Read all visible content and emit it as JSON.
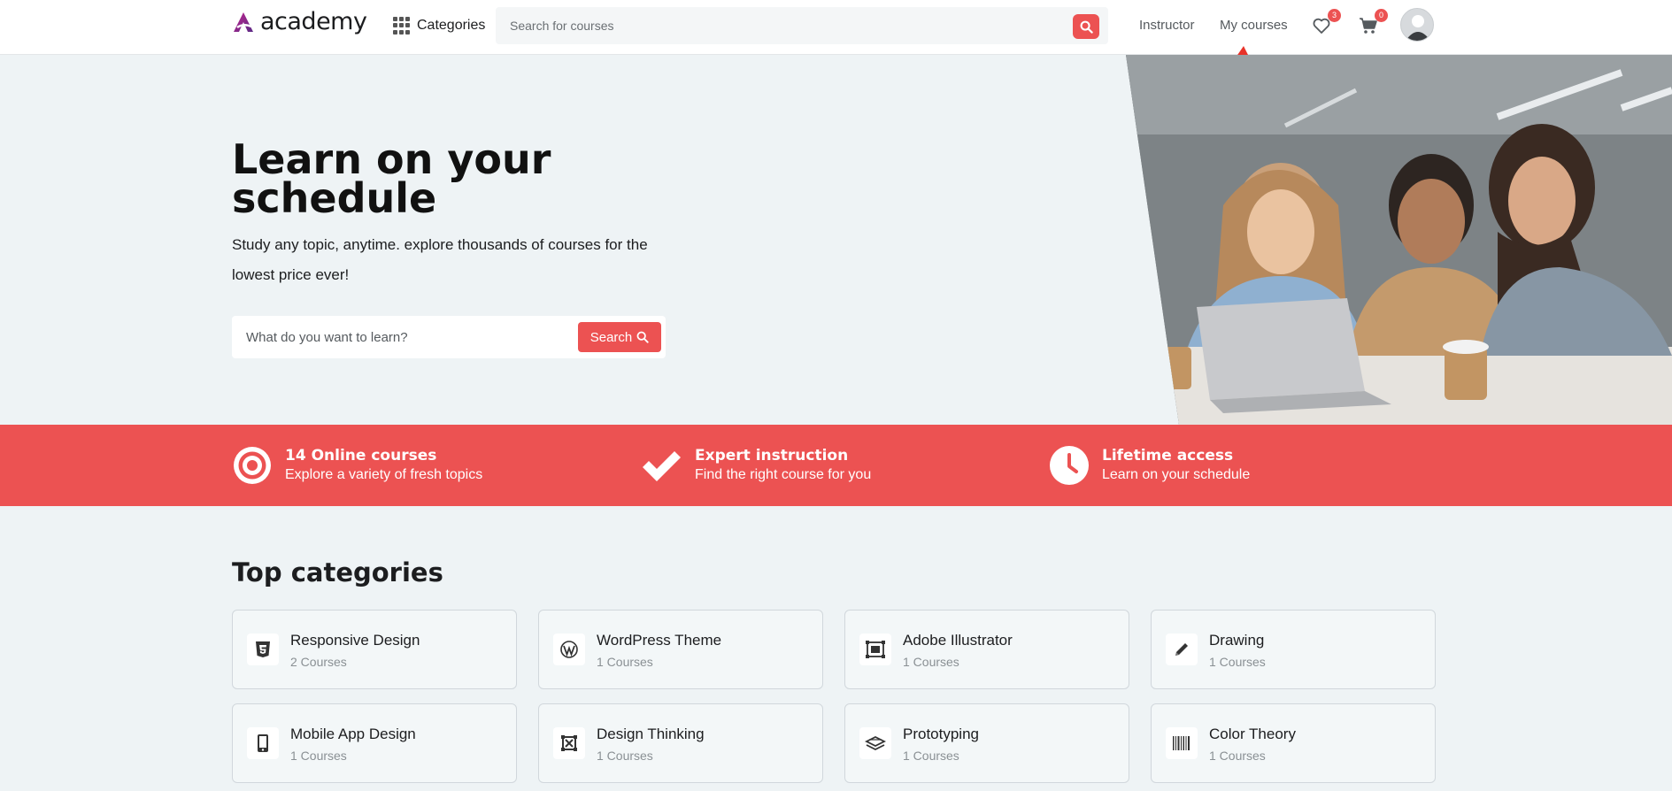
{
  "header": {
    "logo_text": "academy",
    "categories_label": "Categories",
    "search_placeholder": "Search for courses",
    "nav": {
      "instructor": "Instructor",
      "my_courses": "My courses"
    },
    "wishlist_count": "3",
    "cart_count": "0"
  },
  "hero": {
    "title": "Learn on your schedule",
    "subtitle": "Study any topic, anytime. explore thousands of courses for the lowest price ever!",
    "search_placeholder": "What do you want to learn?",
    "search_button": "Search"
  },
  "features": [
    {
      "title": "14 Online courses",
      "desc": "Explore a variety of fresh topics",
      "icon": "target-icon"
    },
    {
      "title": "Expert instruction",
      "desc": "Find the right course for you",
      "icon": "check-icon"
    },
    {
      "title": "Lifetime access",
      "desc": "Learn on your schedule",
      "icon": "clock-icon"
    }
  ],
  "top_categories": {
    "title": "Top categories",
    "items": [
      {
        "name": "Responsive Design",
        "count": "2 Courses",
        "icon": "html5-icon"
      },
      {
        "name": "WordPress Theme",
        "count": "1 Courses",
        "icon": "wordpress-icon"
      },
      {
        "name": "Adobe Illustrator",
        "count": "1 Courses",
        "icon": "illustrator-icon"
      },
      {
        "name": "Drawing",
        "count": "1 Courses",
        "icon": "pencil-icon"
      },
      {
        "name": "Mobile App Design",
        "count": "1 Courses",
        "icon": "mobile-icon"
      },
      {
        "name": "Design Thinking",
        "count": "1 Courses",
        "icon": "design-icon"
      },
      {
        "name": "Prototyping",
        "count": "1 Courses",
        "icon": "layers-icon"
      },
      {
        "name": "Color Theory",
        "count": "1 Courses",
        "icon": "barcode-icon"
      }
    ]
  },
  "colors": {
    "accent": "#ec5252",
    "background": "#eef3f5",
    "header": "#ffffff"
  }
}
